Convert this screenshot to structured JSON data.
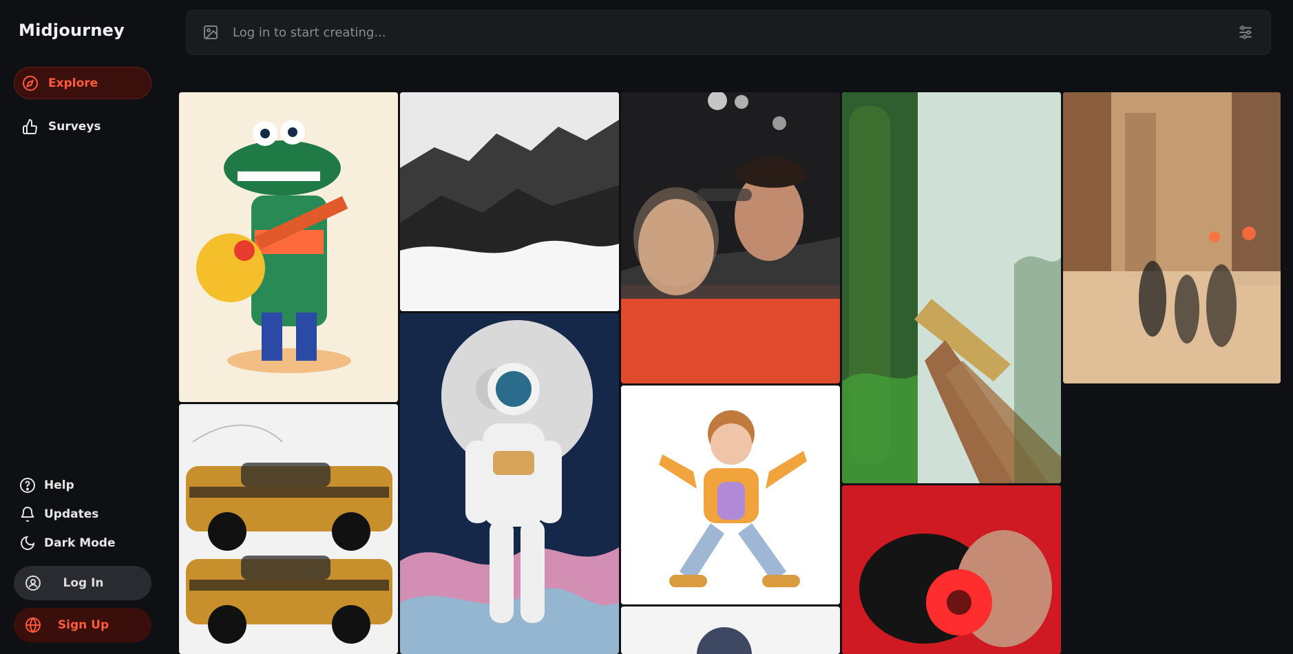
{
  "app": {
    "brand": "Midjourney"
  },
  "sidebar": {
    "items": [
      {
        "label": "Explore",
        "icon": "compass-icon",
        "active": true
      },
      {
        "label": "Surveys",
        "icon": "thumbs-up-icon",
        "active": false
      }
    ],
    "bottom": [
      {
        "label": "Help",
        "icon": "help-icon"
      },
      {
        "label": "Updates",
        "icon": "bell-icon"
      },
      {
        "label": "Dark Mode",
        "icon": "moon-icon"
      }
    ],
    "login_label": "Log In",
    "signup_label": "Sign Up"
  },
  "search": {
    "placeholder": "Log in to start creating...",
    "left_icon": "image-icon",
    "right_icon": "sliders-icon"
  },
  "gallery": {
    "items": [
      {
        "name": "gallery-item-crocodile-guitar"
      },
      {
        "name": "gallery-item-monochrome-mountains"
      },
      {
        "name": "gallery-item-couple-in-car"
      },
      {
        "name": "gallery-item-forest-boardwalk"
      },
      {
        "name": "gallery-item-city-street-rain"
      },
      {
        "name": "gallery-item-car-sketch"
      },
      {
        "name": "gallery-item-astronaut-moon"
      },
      {
        "name": "gallery-item-dancing-girl"
      },
      {
        "name": "gallery-item-woman-red-flower"
      },
      {
        "name": "gallery-item-partial-bottom"
      }
    ]
  },
  "colors": {
    "accent": "#ff5a3b",
    "background": "#0f1014",
    "search_bg": "#1a1b1f"
  }
}
